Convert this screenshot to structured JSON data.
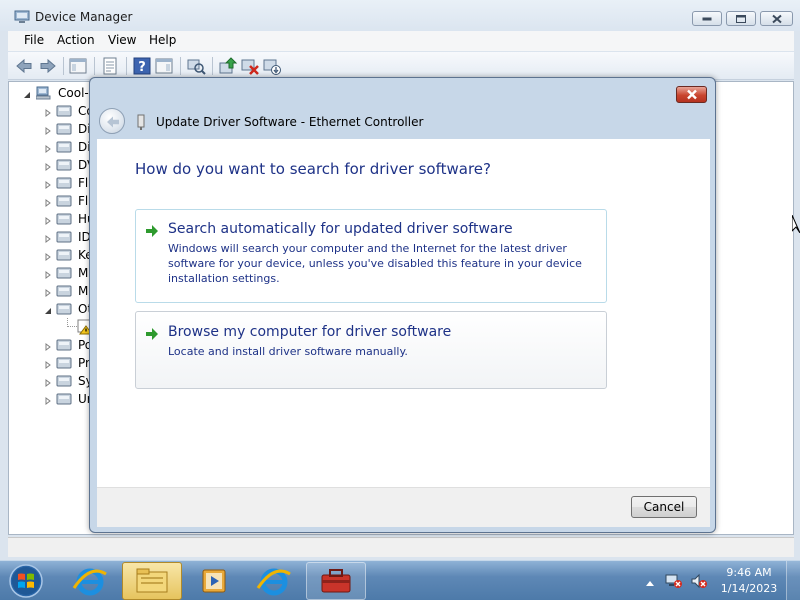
{
  "window": {
    "title": "Device Manager",
    "menu": [
      "File",
      "Action",
      "View",
      "Help"
    ]
  },
  "tree": {
    "root_label": "Cool-",
    "items": [
      {
        "label": "Co",
        "icon": "computer-icon",
        "expanded": false
      },
      {
        "label": "Di",
        "icon": "disk-drive-icon",
        "expanded": false
      },
      {
        "label": "Di",
        "icon": "display-adapter-icon",
        "expanded": false
      },
      {
        "label": "DV",
        "icon": "dvd-drive-icon",
        "expanded": false
      },
      {
        "label": "Fl",
        "icon": "floppy-controller-icon",
        "expanded": false
      },
      {
        "label": "Fl",
        "icon": "floppy-drive-icon",
        "expanded": false
      },
      {
        "label": "Hu",
        "icon": "hid-icon",
        "expanded": false
      },
      {
        "label": "ID",
        "icon": "ide-controller-icon",
        "expanded": false
      },
      {
        "label": "Ke",
        "icon": "keyboard-icon",
        "expanded": false
      },
      {
        "label": "M",
        "icon": "mouse-icon",
        "expanded": false
      },
      {
        "label": "M",
        "icon": "monitor-icon",
        "expanded": false
      },
      {
        "label": "Ot",
        "icon": "other-devices-icon",
        "expanded": true
      },
      {
        "label": "",
        "icon": "warning-device-icon",
        "expanded": false
      },
      {
        "label": "Po",
        "icon": "ports-icon",
        "expanded": false
      },
      {
        "label": "Pr",
        "icon": "processor-icon",
        "expanded": false
      },
      {
        "label": "Sy",
        "icon": "system-devices-icon",
        "expanded": false
      },
      {
        "label": "Ur",
        "icon": "usb-icon",
        "expanded": false
      }
    ]
  },
  "dialog": {
    "title": "Update Driver Software - Ethernet Controller",
    "heading": "How do you want to search for driver software?",
    "options": [
      {
        "title": "Search automatically for updated driver software",
        "description": "Windows will search your computer and the Internet for the latest driver software for your device, unless you've disabled this feature in your device installation settings."
      },
      {
        "title": "Browse my computer for driver software",
        "description": "Locate and install driver software manually."
      }
    ],
    "cancel_label": "Cancel"
  },
  "taskbar": {
    "time": "9:46 AM",
    "date": "1/14/2023"
  },
  "colors": {
    "link_blue": "#1e3287",
    "option_arrow_green": "#2e9a2e",
    "close_red": "#c9452f",
    "taskbar_blue": "#5e88b6"
  }
}
